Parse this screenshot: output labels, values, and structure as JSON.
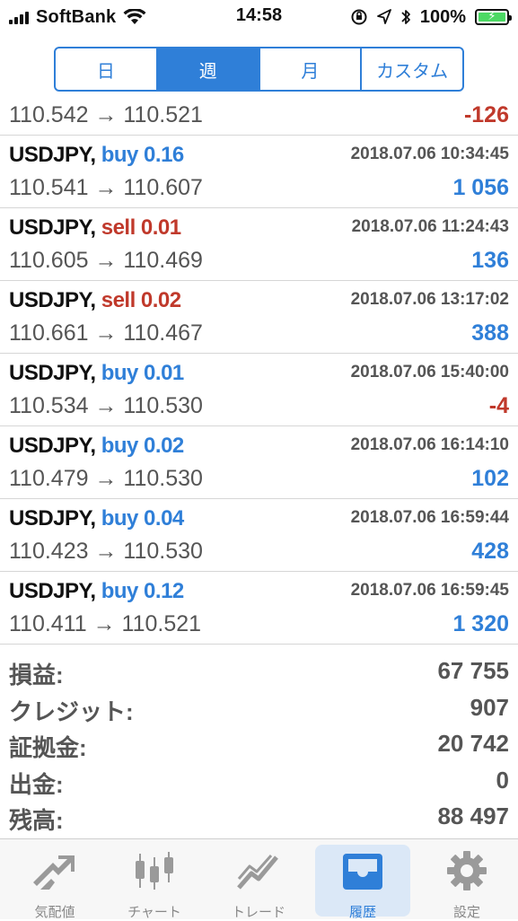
{
  "status": {
    "carrier": "SoftBank",
    "time": "14:58",
    "battery_pct": "100%",
    "battery_level": 1.0,
    "signal_bars": 4
  },
  "segment": {
    "tabs": [
      {
        "label": "日",
        "active": false
      },
      {
        "label": "週",
        "active": true
      },
      {
        "label": "月",
        "active": false
      },
      {
        "label": "カスタム",
        "active": false
      }
    ]
  },
  "partial_trade": {
    "price": "110.542 → 110.521",
    "profit": "-126"
  },
  "trades": [
    {
      "symbol": "USDJPY,",
      "side": "buy",
      "volume": "0.16",
      "side_text": "buy 0.16",
      "time": "2018.07.06 10:34:45",
      "price": "110.541 → 110.607",
      "profit": "1 056"
    },
    {
      "symbol": "USDJPY,",
      "side": "sell",
      "volume": "0.01",
      "side_text": "sell 0.01",
      "time": "2018.07.06 11:24:43",
      "price": "110.605 → 110.469",
      "profit": "136"
    },
    {
      "symbol": "USDJPY,",
      "side": "sell",
      "volume": "0.02",
      "side_text": "sell 0.02",
      "time": "2018.07.06 13:17:02",
      "price": "110.661 → 110.467",
      "profit": "388"
    },
    {
      "symbol": "USDJPY,",
      "side": "buy",
      "volume": "0.01",
      "side_text": "buy 0.01",
      "time": "2018.07.06 15:40:00",
      "price": "110.534 → 110.530",
      "profit": "-4"
    },
    {
      "symbol": "USDJPY,",
      "side": "buy",
      "volume": "0.02",
      "side_text": "buy 0.02",
      "time": "2018.07.06 16:14:10",
      "price": "110.479 → 110.530",
      "profit": "102"
    },
    {
      "symbol": "USDJPY,",
      "side": "buy",
      "volume": "0.04",
      "side_text": "buy 0.04",
      "time": "2018.07.06 16:59:44",
      "price": "110.423 → 110.530",
      "profit": "428"
    },
    {
      "symbol": "USDJPY,",
      "side": "buy",
      "volume": "0.12",
      "side_text": "buy 0.12",
      "time": "2018.07.06 16:59:45",
      "price": "110.411 → 110.521",
      "profit": "1 320"
    }
  ],
  "summary": [
    {
      "label": "損益:",
      "value": "67 755"
    },
    {
      "label": "クレジット:",
      "value": "907"
    },
    {
      "label": "証拠金:",
      "value": "20 742"
    },
    {
      "label": "出金:",
      "value": "0"
    },
    {
      "label": "残高:",
      "value": "88 497"
    }
  ],
  "tabbar": [
    {
      "label": "気配値",
      "icon": "quotes-arrows-icon",
      "active": false
    },
    {
      "label": "チャート",
      "icon": "candlestick-chart-icon",
      "active": false
    },
    {
      "label": "トレード",
      "icon": "trade-chart-icon",
      "active": false
    },
    {
      "label": "履歴",
      "icon": "history-inbox-icon",
      "active": true
    },
    {
      "label": "設定",
      "icon": "gear-icon",
      "active": false
    }
  ],
  "colors": {
    "accent": "#2f7fd8",
    "loss": "#c0392b",
    "battery": "#4cd964",
    "active_tab_bg": "#dbe8f7"
  }
}
